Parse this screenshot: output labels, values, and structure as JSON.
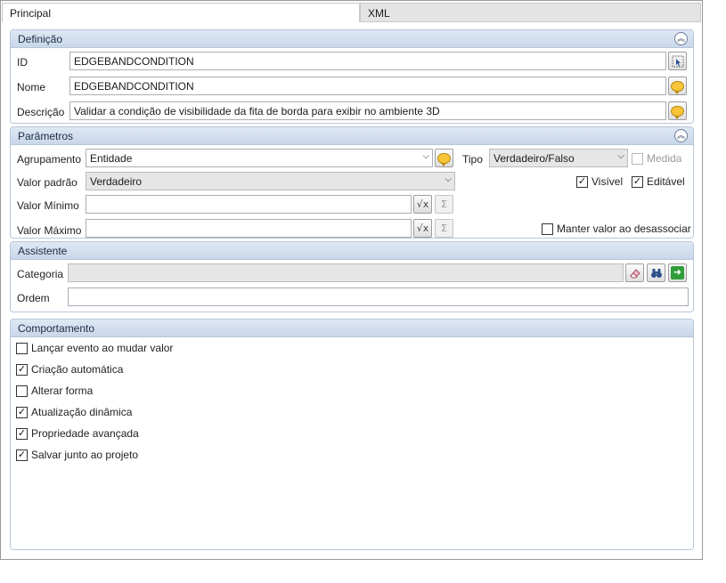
{
  "tabs": {
    "principal": "Principal",
    "xml": "XML"
  },
  "definicao": {
    "title": "Definição",
    "id_label": "ID",
    "id_value": "EDGEBANDCONDITION",
    "nome_label": "Nome",
    "nome_value": "EDGEBANDCONDITION",
    "descricao_label": "Descrição",
    "descricao_value": "Validar a condição de visibilidade da fita de borda para exibir no ambiente 3D"
  },
  "parametros": {
    "title": "Parâmetros",
    "agrupamento_label": "Agrupamento",
    "agrupamento_value": "Entidade",
    "tipo_label": "Tipo",
    "tipo_value": "Verdadeiro/Falso",
    "medida_label": "Medida",
    "valor_padrao_label": "Valor padrão",
    "valor_padrao_value": "Verdadeiro",
    "visivel_label": "Visível",
    "editavel_label": "Editável",
    "valor_minimo_label": "Valor Mínimo",
    "valor_minimo_value": "",
    "valor_maximo_label": "Valor Máximo",
    "valor_maximo_value": "",
    "manter_label": "Manter valor ao desassociar"
  },
  "assistente": {
    "title": "Assistente",
    "categoria_label": "Categoria",
    "categoria_value": "",
    "ordem_label": "Ordem",
    "ordem_value": ""
  },
  "comportamento": {
    "title": "Comportamento",
    "items": [
      {
        "label": "Lançar evento ao mudar valor",
        "checked": false
      },
      {
        "label": "Criação automática",
        "checked": true
      },
      {
        "label": "Alterar forma",
        "checked": false
      },
      {
        "label": "Atualização dinâmica",
        "checked": true
      },
      {
        "label": "Propriedade avançada",
        "checked": true
      },
      {
        "label": "Salvar junto ao projeto",
        "checked": true
      }
    ]
  }
}
